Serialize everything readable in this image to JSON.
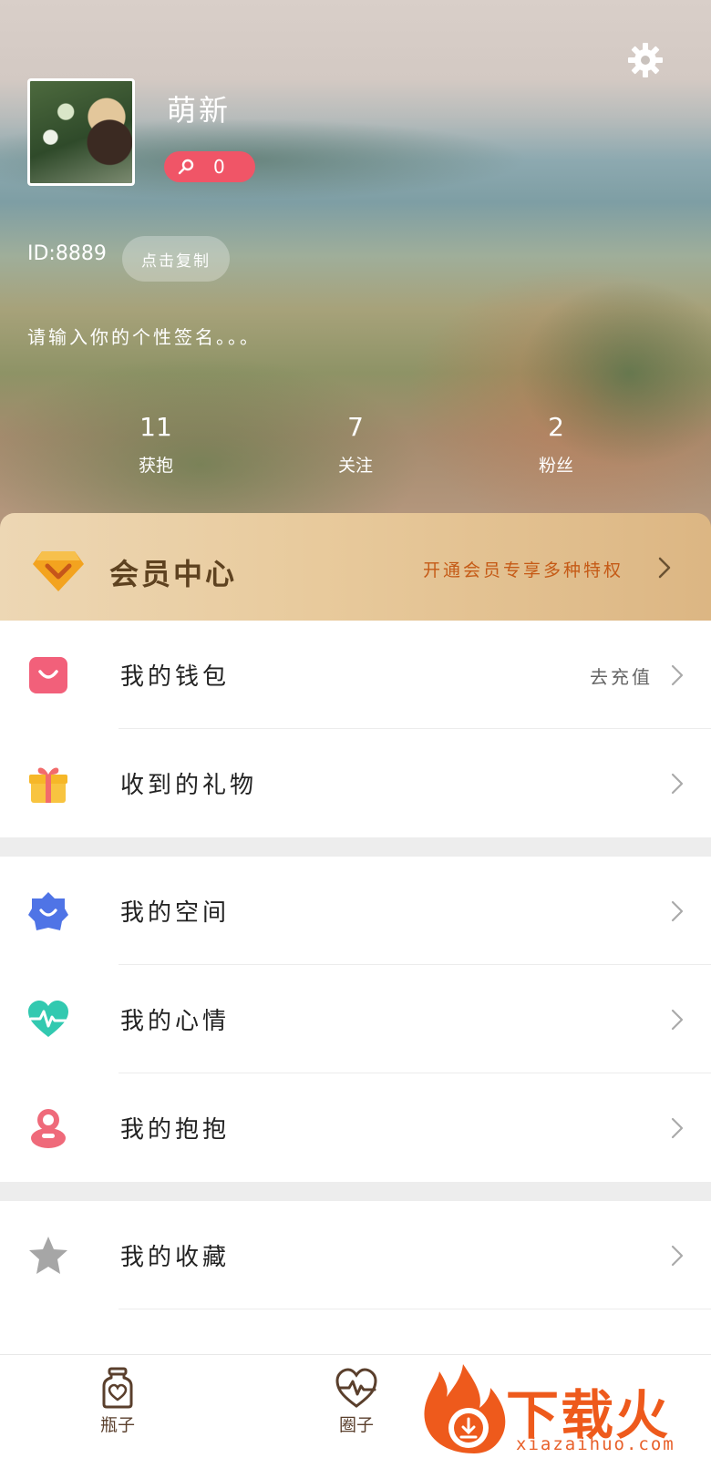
{
  "profile": {
    "username": "萌新",
    "badge_count": "0",
    "id_text": "ID:8889",
    "copy_label": "点击复制",
    "signature": "请输入你的个性签名。。。"
  },
  "stats": [
    {
      "value": "11",
      "label": "获抱"
    },
    {
      "value": "7",
      "label": "关注"
    },
    {
      "value": "2",
      "label": "粉丝"
    }
  ],
  "vip": {
    "title": "会员中心",
    "promo": "开通会员专享多种特权"
  },
  "menu_groups": [
    [
      {
        "label": "我的钱包",
        "extra": "去充值",
        "icon": "wallet-bag-icon"
      },
      {
        "label": "收到的礼物",
        "extra": "",
        "icon": "gift-icon"
      }
    ],
    [
      {
        "label": "我的空间",
        "extra": "",
        "icon": "space-flower-icon"
      },
      {
        "label": "我的心情",
        "extra": "",
        "icon": "heart-pulse-icon"
      },
      {
        "label": "我的抱抱",
        "extra": "",
        "icon": "hug-icon"
      }
    ],
    [
      {
        "label": "我的收藏",
        "extra": "",
        "icon": "star-icon"
      }
    ]
  ],
  "bottom_nav": [
    {
      "label": "瓶子",
      "icon": "bottle-icon"
    },
    {
      "label": "圈子",
      "icon": "heart-circle-icon"
    }
  ],
  "watermark": {
    "text": "下载火",
    "url": "xiazaihuo.com"
  },
  "colors": {
    "badge": "#f05567",
    "vip_promo": "#c55a16",
    "vip_title": "#5e4220",
    "nav_label": "#5a3f2c"
  }
}
